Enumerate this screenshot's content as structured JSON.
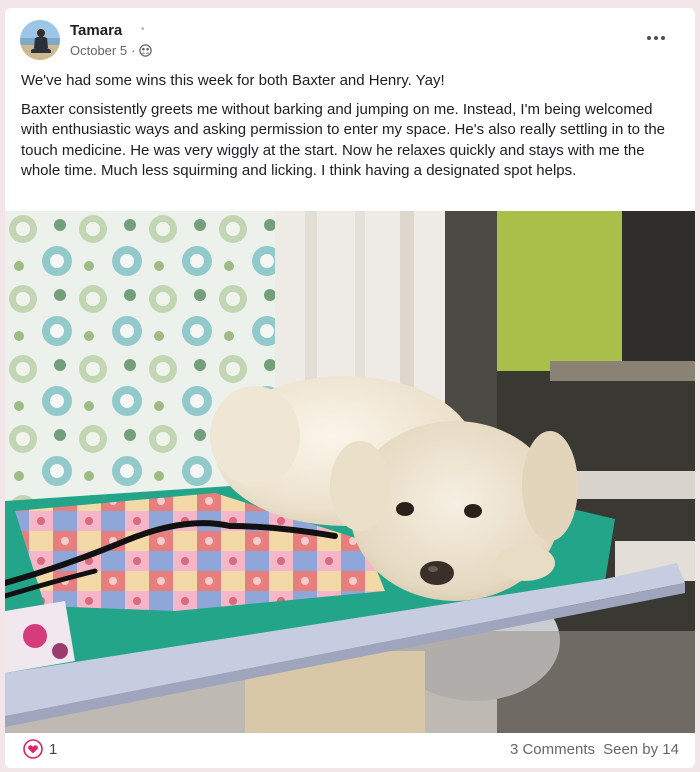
{
  "post": {
    "author": "Tamara",
    "date": "October 5",
    "date_separator": "·",
    "audience_icon": "group-audience-icon",
    "menu_icon": "more-options-icon",
    "paragraphs": [
      "We've had some wins this week for both Baxter and Henry. Yay!",
      "Baxter consistently greets me without barking and jumping on me. Instead, I'm being welcomed with enthusiastic ways and asking permission to enter my space. He's also really settling in to the touch medicine. He was very wiggly at the start. Now he relaxes quickly and stays with me the whole time. Much less squirming and licking. I think having a designated spot helps."
    ],
    "photo_subject": "white-dog-on-quilt-photo"
  },
  "footer": {
    "reaction_icon": "heart-icon",
    "reaction_color": "#e0245e",
    "like_count": "1",
    "comments": "3 Comments",
    "seen_by": "Seen by 14"
  },
  "colors": {
    "background": "#f3e6e8",
    "card": "#ffffff",
    "text": "#1c1e21",
    "muted": "#65676b"
  }
}
